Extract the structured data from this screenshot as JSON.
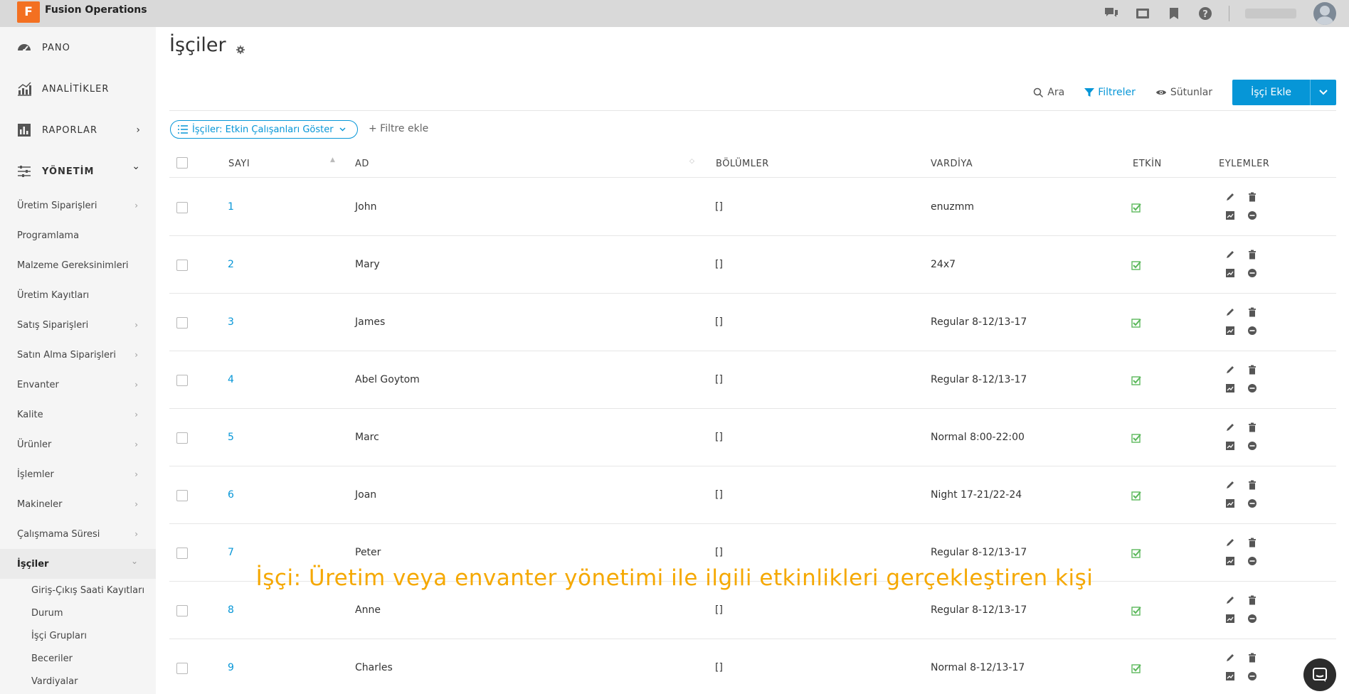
{
  "app": {
    "logo_letter": "F",
    "name": "Fusion Operations"
  },
  "sidebar": {
    "main_items": [
      {
        "label": "PANO",
        "icon": "dashboard-icon"
      },
      {
        "label": "ANALİTİKLER",
        "icon": "analytics-icon"
      },
      {
        "label": "RAPORLAR",
        "icon": "reports-icon",
        "chevron": "›"
      },
      {
        "label": "YÖNETİM",
        "icon": "settings-sliders-icon",
        "chevron": "⌄"
      }
    ],
    "sub_items": [
      {
        "label": "Üretim Siparişleri",
        "chevron": "›"
      },
      {
        "label": "Programlama",
        "chevron": ""
      },
      {
        "label": "Malzeme Gereksinimleri",
        "chevron": ""
      },
      {
        "label": "Üretim Kayıtları",
        "chevron": ""
      },
      {
        "label": "Satış Siparişleri",
        "chevron": "›"
      },
      {
        "label": "Satın Alma Siparişleri",
        "chevron": "›"
      },
      {
        "label": "Envanter",
        "chevron": "›"
      },
      {
        "label": "Kalite",
        "chevron": "›"
      },
      {
        "label": "Ürünler",
        "chevron": "›"
      },
      {
        "label": "İşlemler",
        "chevron": "›"
      },
      {
        "label": "Makineler",
        "chevron": "›"
      },
      {
        "label": "Çalışmama Süresi",
        "chevron": "›"
      },
      {
        "label": "İşçiler",
        "chevron": "⌄"
      }
    ],
    "worker_sub_items": [
      {
        "label": "Giriş-Çıkış Saati Kayıtları"
      },
      {
        "label": "Durum"
      },
      {
        "label": "İşçi Grupları"
      },
      {
        "label": "Beceriler"
      },
      {
        "label": "Vardiyalar"
      }
    ]
  },
  "page": {
    "title": "İşçiler"
  },
  "toolbar": {
    "search_label": "Ara",
    "filters_label": "Filtreler",
    "columns_label": "Sütunlar",
    "add_label": "İşçi Ekle"
  },
  "filter": {
    "chip_label": "İşçiler: Etkin Çalışanları Göster",
    "add_filter_label": "+ Filtre ekle"
  },
  "table": {
    "headers": {
      "number": "SAYI",
      "name": "AD",
      "departments": "BÖLÜMLER",
      "shift": "VARDİYA",
      "active": "ETKİN",
      "actions": "EYLEMLER"
    },
    "rows": [
      {
        "number": "1",
        "name": "John",
        "departments": "[]",
        "shift": "enuzmm",
        "active": true
      },
      {
        "number": "2",
        "name": "Mary",
        "departments": "[]",
        "shift": "24x7",
        "active": true
      },
      {
        "number": "3",
        "name": "James",
        "departments": "[]",
        "shift": "Regular 8-12/13-17",
        "active": true
      },
      {
        "number": "4",
        "name": "Abel Goytom",
        "departments": "[]",
        "shift": "Regular 8-12/13-17",
        "active": true
      },
      {
        "number": "5",
        "name": "Marc",
        "departments": "[]",
        "shift": "Normal 8:00-22:00",
        "active": true
      },
      {
        "number": "6",
        "name": "Joan",
        "departments": "[]",
        "shift": "Night 17-21/22-24",
        "active": true
      },
      {
        "number": "7",
        "name": "Peter",
        "departments": "[]",
        "shift": "Regular 8-12/13-17",
        "active": true
      },
      {
        "number": "8",
        "name": "Anne",
        "departments": "[]",
        "shift": "Regular 8-12/13-17",
        "active": true
      },
      {
        "number": "9",
        "name": "Charles",
        "departments": "[]",
        "shift": "Normal 8-12/13-17",
        "active": true
      }
    ]
  },
  "caption": "İşçi: Üretim veya envanter yönetimi ile ilgili etkinlikleri gerçekleştiren kişi",
  "colors": {
    "accent": "#0696d7",
    "brand": "#f37021",
    "active_check": "#5cb85c",
    "caption": "#f5a800"
  }
}
